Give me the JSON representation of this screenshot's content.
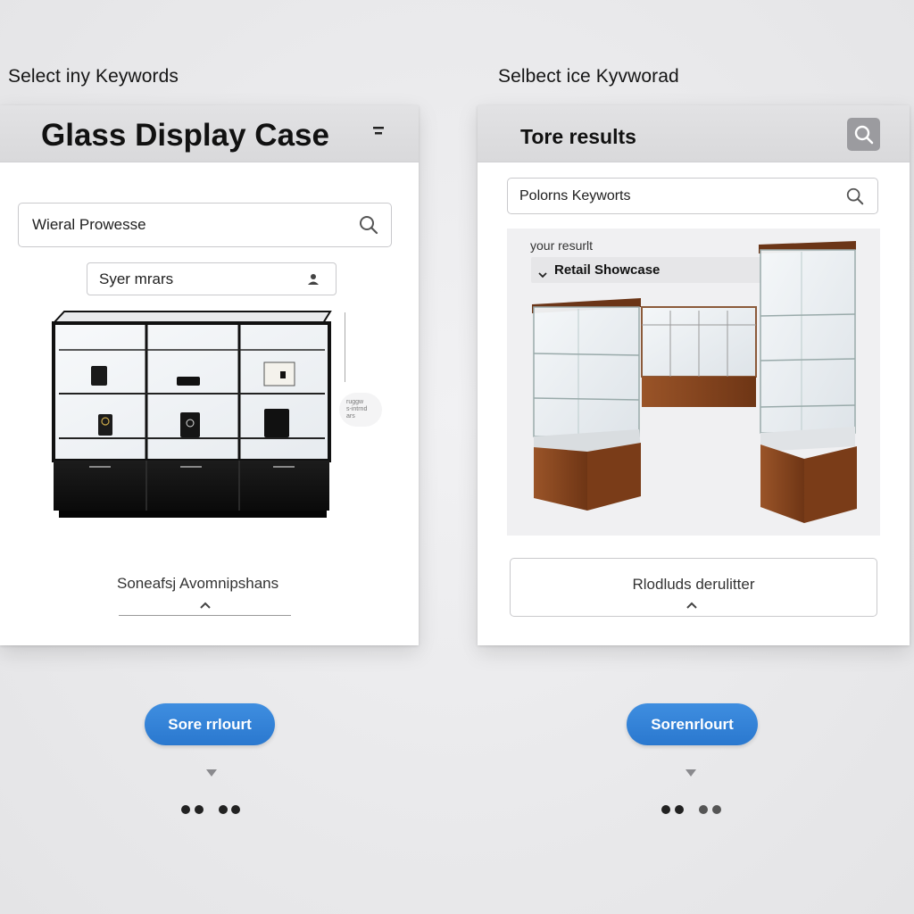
{
  "left": {
    "page_label": "Select iny Keywords",
    "title": "Glass Display Case",
    "search": {
      "value": "Wieral Prowesse"
    },
    "filter": {
      "value": "Syer mrars"
    },
    "side_note": [
      "ruggw",
      "s-intrnd",
      "ars"
    ],
    "footer_label": "Soneafsj Avomnipshans",
    "button_label": "Sore rrlourt",
    "pager": {
      "dots": 4,
      "active": [
        0,
        1,
        2,
        3
      ]
    }
  },
  "right": {
    "page_label": "Selbect ice Kyvworad",
    "title": "Tore results",
    "search": {
      "value": "Polorns Keyworts"
    },
    "result_caption": "your resurlt",
    "result_dropdown": "Retail Showcase",
    "footer_label": "Rlodluds derulitter",
    "button_label": "Sorenrlourt"
  },
  "colors": {
    "accent": "#2f7fd5",
    "header_bg": "#dcdcde",
    "wood": "#8a4a22"
  },
  "icons": [
    "menu-icon",
    "search-icon",
    "user-icon",
    "chevron-up-icon",
    "chevron-down-icon",
    "caret-down-icon"
  ]
}
